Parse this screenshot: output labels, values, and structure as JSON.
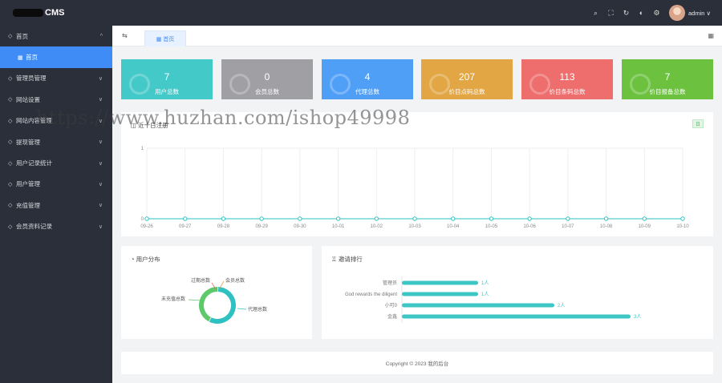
{
  "app": {
    "brand": "CMS"
  },
  "header": {
    "user_name": "admin ∨",
    "icons": [
      "search-icon",
      "fullscreen-icon",
      "refresh-icon",
      "theme-icon",
      "settings-icon"
    ]
  },
  "sidebar": {
    "items": [
      {
        "label": "首页",
        "icon": "home-icon",
        "caret": "^"
      },
      {
        "label": "首页",
        "icon": "dashboard-icon",
        "active": true,
        "sub": true
      },
      {
        "label": "管理员管理",
        "icon": "admin-icon",
        "caret": "∨"
      },
      {
        "label": "网站设置",
        "icon": "settings-icon",
        "caret": "∨"
      },
      {
        "label": "网站内容管理",
        "icon": "content-icon",
        "caret": "∨"
      },
      {
        "label": "提现管理",
        "icon": "withdraw-icon",
        "caret": "∨"
      },
      {
        "label": "用户记录统计",
        "icon": "stats-icon",
        "caret": "∨"
      },
      {
        "label": "用户管理",
        "icon": "user-icon",
        "caret": "∨"
      },
      {
        "label": "充值管理",
        "icon": "recharge-icon",
        "caret": "∨"
      },
      {
        "label": "会员资料记录",
        "icon": "record-icon",
        "caret": "∨"
      }
    ]
  },
  "tabs": {
    "fold_icon": "⇆",
    "home_tab": "首页"
  },
  "stats": [
    {
      "value": "7",
      "label": "用户总数",
      "color": "#44c9c9"
    },
    {
      "value": "0",
      "label": "会员总数",
      "color": "#a0a0a4"
    },
    {
      "value": "4",
      "label": "代理总数",
      "color": "#4f9ff7"
    },
    {
      "value": "207",
      "label": "价目点码总数",
      "color": "#e2a644"
    },
    {
      "value": "113",
      "label": "价目条码总数",
      "color": "#ee6d6d"
    },
    {
      "value": "7",
      "label": "价目报备总数",
      "color": "#6cc13f"
    }
  ],
  "line_panel": {
    "title": "近十日注册",
    "badge": "日"
  },
  "chart_data": [
    {
      "type": "line",
      "title": "近十日注册",
      "categories": [
        "09-26",
        "09-27",
        "09-28",
        "09-29",
        "09-30",
        "10-01",
        "10-02",
        "10-03",
        "10-04",
        "10-05",
        "10-06",
        "10-07",
        "10-08",
        "10-09",
        "10-10"
      ],
      "values": [
        0,
        0,
        0,
        0,
        0,
        0,
        0,
        0,
        0,
        0,
        0,
        0,
        0,
        0,
        0
      ],
      "ylim": [
        0,
        1
      ],
      "yticks": [
        "0",
        "1"
      ],
      "color": "#2fc1c1",
      "grid": true
    },
    {
      "type": "pie",
      "title": "用户分布",
      "series": [
        {
          "name": "代理总数",
          "value": 4,
          "color": "#2fc1c1"
        },
        {
          "name": "会员总数",
          "value": 0,
          "color": "#e2a644"
        },
        {
          "name": "过期总数",
          "value": 0,
          "color": "#ee6d6d"
        },
        {
          "name": "未充值总数",
          "value": 3,
          "color": "#5ec96b"
        }
      ]
    },
    {
      "type": "bar",
      "title": "邀请排行",
      "categories": [
        "管理员",
        "God rewards the diligent",
        "小可0",
        "金鑫"
      ],
      "values": [
        1,
        1,
        2,
        3
      ],
      "value_labels": [
        "1人",
        "1人",
        "2人",
        "3人"
      ],
      "xlim": [
        0,
        3
      ],
      "color": "#3cc6c6"
    }
  ],
  "pie_panel": {
    "title": "用户分布"
  },
  "rank_panel": {
    "title": "邀请排行"
  },
  "footer": {
    "text": "Copyright © 2023 我的后台"
  },
  "watermark": "https://www.huzhan.com/ishop49998"
}
